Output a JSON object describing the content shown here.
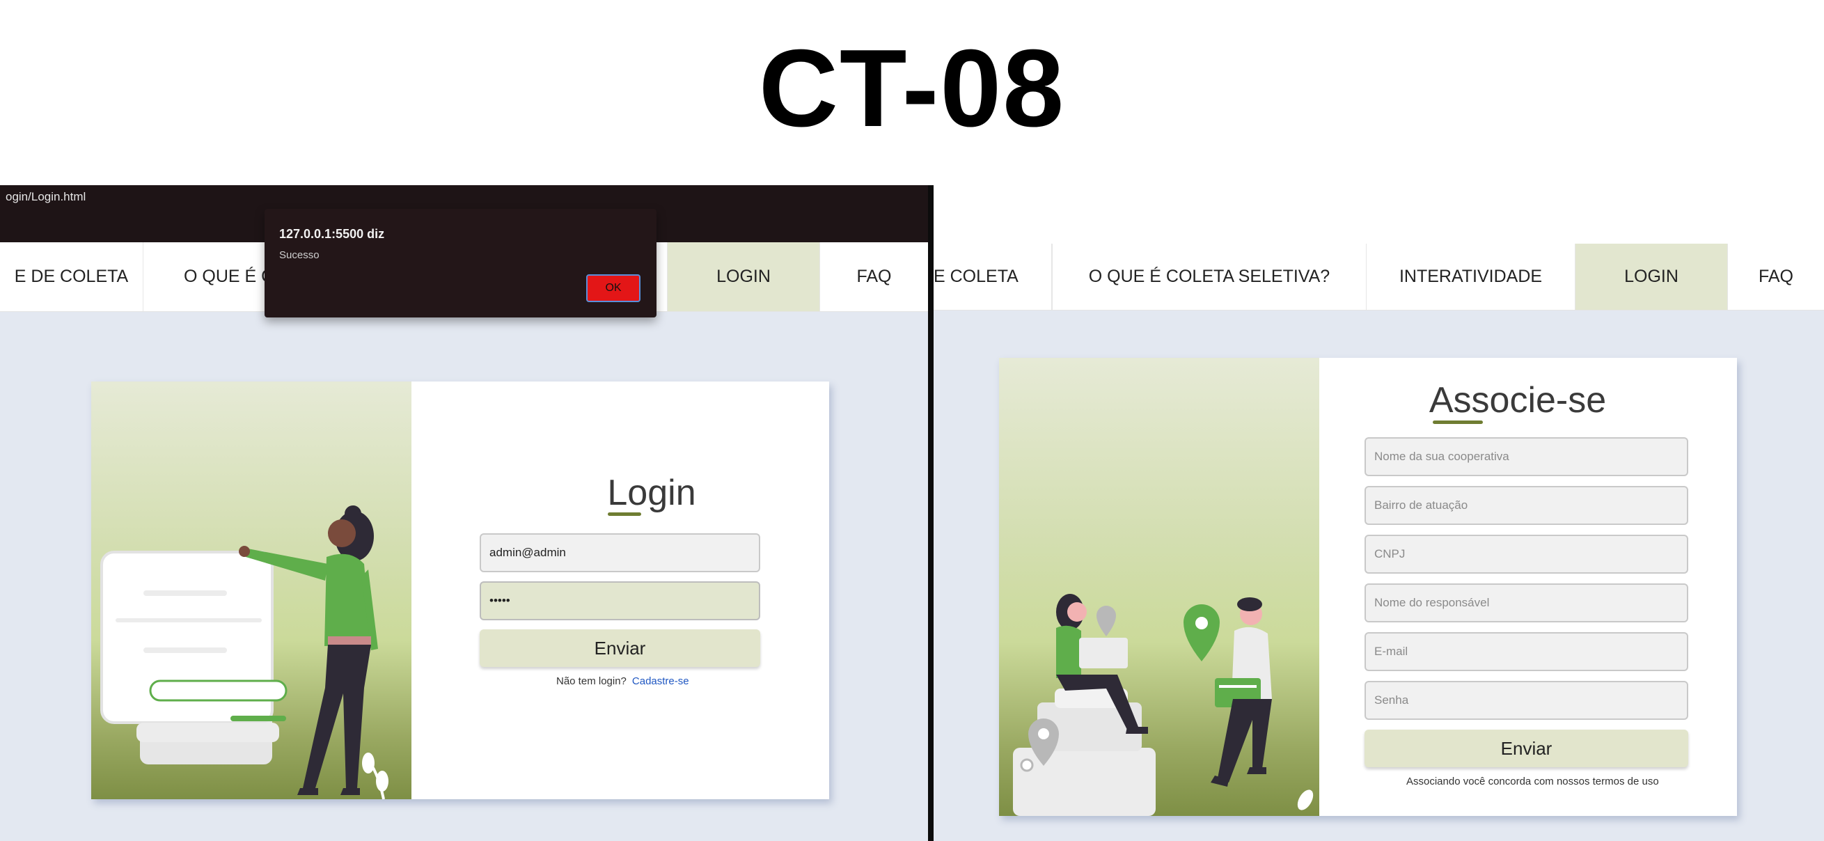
{
  "heading": "CT-08",
  "left": {
    "url_fragment": "ogin/Login.html",
    "nav": [
      "E DE COLETA",
      "O QUE É C",
      "LOGIN",
      "FAQ"
    ],
    "form": {
      "title": "Login",
      "email_value": "admin@admin",
      "password_value": "•••••",
      "submit_label": "Enviar",
      "no_account_text": "Não tem login?",
      "signup_link": "Cadastre-se"
    },
    "alert": {
      "title": "127.0.0.1:5500 diz",
      "message": "Sucesso",
      "ok_label": "OK"
    }
  },
  "right": {
    "nav": [
      "E COLETA",
      "O QUE É COLETA SELETIVA?",
      "INTERATIVIDADE",
      "LOGIN",
      "FAQ"
    ],
    "form": {
      "title": "Associe-se",
      "placeholders": [
        "Nome da sua cooperativa",
        "Bairro de atuação",
        "CNPJ",
        "Nome do responsável",
        "E-mail",
        "Senha"
      ],
      "submit_label": "Enviar",
      "terms_text": "Associando você concorda com nossos termos de uso"
    }
  },
  "colors": {
    "active_nav": "#e2e6cf",
    "page_bg": "#e3e8f1",
    "accent_green": "#6f7d32",
    "link_blue": "#1f57c2",
    "alert_ok": "#e31617"
  }
}
